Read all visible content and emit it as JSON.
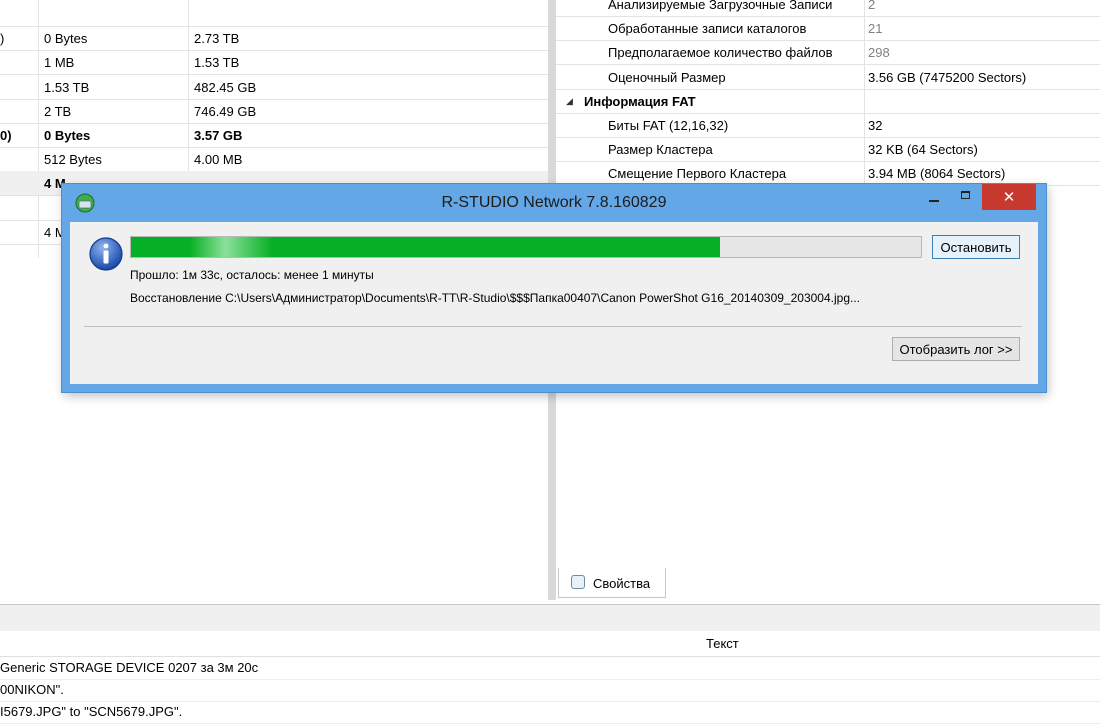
{
  "left_grid": {
    "rows": [
      {
        "c0": "",
        "c1": "",
        "c2": "",
        "bold": false,
        "sel": false
      },
      {
        "c0": ")",
        "c1": "0 Bytes",
        "c2": "2.73 TB",
        "bold": false,
        "sel": false
      },
      {
        "c0": "",
        "c1": "1 MB",
        "c2": "1.53 TB",
        "bold": false,
        "sel": false
      },
      {
        "c0": "",
        "c1": "1.53 TB",
        "c2": "482.45 GB",
        "bold": false,
        "sel": false
      },
      {
        "c0": "",
        "c1": "2 TB",
        "c2": "746.49 GB",
        "bold": false,
        "sel": false
      },
      {
        "c0": "0)",
        "c1": "0 Bytes",
        "c2": "3.57 GB",
        "bold": true,
        "sel": false
      },
      {
        "c0": "",
        "c1": "512 Bytes",
        "c2": "4.00 MB",
        "bold": false,
        "sel": false
      },
      {
        "c0": "",
        "c1": "4 M",
        "c2": "",
        "bold": true,
        "sel": true
      },
      {
        "c0": "",
        "c1": "",
        "c2": "",
        "bold": false,
        "sel": false
      },
      {
        "c0": "",
        "c1": "4 M",
        "c2": "",
        "bold": false,
        "sel": false
      }
    ]
  },
  "properties": {
    "rows": [
      {
        "key": "Анализируемые Загрузочные Записи",
        "value": "2",
        "grey": true
      },
      {
        "key": "Обработанные записи каталогов",
        "value": "21",
        "grey": true
      },
      {
        "key": "Предполагаемое количество файлов",
        "value": "298",
        "grey": true
      },
      {
        "key": "Оценочный Размер",
        "value": "3.56 GB (7475200 Sectors)",
        "grey": false
      },
      {
        "key": "Информация FAT",
        "value": "",
        "group": true
      },
      {
        "key": "Биты FAT (12,16,32)",
        "value": "32",
        "grey": false
      },
      {
        "key": "Размер Кластера",
        "value": "32 KB (64 Sectors)",
        "grey": false
      },
      {
        "key": "Смещение Первого Кластера",
        "value": "3.94 MB (8064 Sectors)",
        "grey": false
      }
    ],
    "tab_label": "Свойства"
  },
  "log": {
    "header": "Текст",
    "lines": [
      " Generic STORAGE DEVICE 0207 за 3м 20с",
      "00NIKON\".",
      "I5679.JPG\" to \"SCN5679.JPG\"."
    ]
  },
  "dialog": {
    "title": "R-STUDIO Network 7.8.160829",
    "close_glyph": "✕",
    "progress": 0.745,
    "elapsed_text": "Прошло: 1м 33с, осталось: менее 1 минуты",
    "current_file": "Восстановление C:\\Users\\Администратор\\Documents\\R-TT\\R-Studio\\$$$Папка00407\\Canon PowerShot G16_20140309_203004.jpg...",
    "stop_label": "Остановить",
    "show_log_label": "Отобразить лог >>",
    "icons": {
      "app": "r-studio-app-icon",
      "info": "info-icon"
    },
    "colors": {
      "frame": "#63a7e6",
      "progress": "#06b025",
      "close": "#c7382e"
    }
  }
}
